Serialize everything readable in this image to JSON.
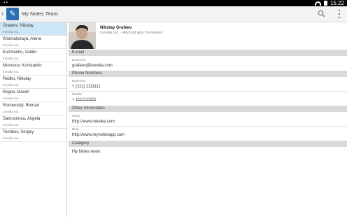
{
  "status_bar": {
    "time": "15:22"
  },
  "action_bar": {
    "back_glyph": "‹",
    "title": "My Notes Team",
    "search_icon": "search-icon",
    "overflow_icon": "overflow-menu-icon"
  },
  "contacts": [
    {
      "name": "Grafeev, Nikolay",
      "org": "Inexika Inc."
    },
    {
      "name": "Khamutskaya, Alena",
      "org": "Inexika Inc."
    },
    {
      "name": "Kuzmenko, Vadim",
      "org": "Inexika Inc."
    },
    {
      "name": "Monosov, Konstantin",
      "org": "Inexika Inc."
    },
    {
      "name": "Redko, Nikolay",
      "org": "Inexika Inc."
    },
    {
      "name": "Rogov, Maxim",
      "org": "Inexika Inc."
    },
    {
      "name": "Romenskiy, Roman",
      "org": "Inexika Inc."
    },
    {
      "name": "Samsonova, Angela",
      "org": "Inexika Inc."
    },
    {
      "name": "Ternikov, Sergey",
      "org": "Inexika Inc."
    }
  ],
  "selected_contact": 0,
  "profile": {
    "name": "Nikolay Grafeev",
    "title": "Inexika Inc. - Android App Developer"
  },
  "sections": {
    "email": {
      "header": "E-mail",
      "label": "Business",
      "value": "grafeev@inexika.com"
    },
    "phone": {
      "header": "Phone Numbers",
      "business_label": "Business",
      "business_value": "+ (111) 1111111",
      "mobile_label": "Mobile",
      "mobile_value": "+ 1111111111"
    },
    "other": {
      "header": "Other Information",
      "work_label": "Work",
      "work_value": "http://www.inexika.com",
      "blog_label": "Blog",
      "blog_value": "http://www.mynotesapp.com"
    },
    "category": {
      "header": "Category",
      "value": "My Notes team"
    }
  },
  "colors": {
    "accent": "#2b6fb5",
    "selected_row": "#cde6f5",
    "section_header": "#d9d9d9"
  }
}
